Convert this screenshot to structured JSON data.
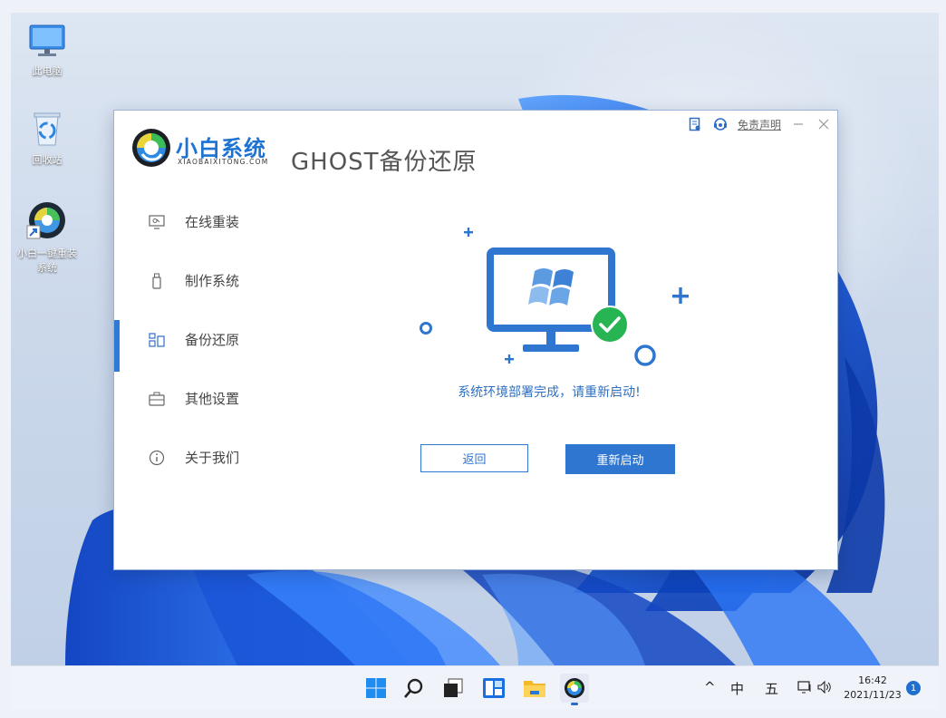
{
  "desktop": {
    "icons": [
      {
        "label": "此电脑"
      },
      {
        "label": "回收站"
      },
      {
        "label_line1": "小白一键重装",
        "label_line2": "系统"
      }
    ]
  },
  "app": {
    "brand_cn": "小白系统",
    "brand_en": "XIAOBAIXITONG.COM",
    "title": "GHOST备份还原",
    "disclaimer": "免责声明",
    "nav": [
      {
        "label": "在线重装",
        "icon": "monitor-icon"
      },
      {
        "label": "制作系统",
        "icon": "usb-icon"
      },
      {
        "label": "备份还原",
        "icon": "backup-icon",
        "active": true
      },
      {
        "label": "其他设置",
        "icon": "briefcase-icon"
      },
      {
        "label": "关于我们",
        "icon": "info-icon"
      }
    ],
    "message": "系统环境部署完成，请重新启动!",
    "back_label": "返回",
    "restart_label": "重新启动",
    "accent_color": "#2e76cf",
    "success_color": "#27b554"
  },
  "taskbar": {
    "apps": [
      "windows-start-icon",
      "search-icon",
      "task-view-icon",
      "widgets-icon",
      "file-explorer-icon",
      "xiaobai-app-icon"
    ],
    "tray": {
      "chevron": "^",
      "ime_lang": "中",
      "ime_mode": "五"
    },
    "clock_time": "16:42",
    "clock_date": "2021/11/23",
    "notification_count": "1"
  }
}
